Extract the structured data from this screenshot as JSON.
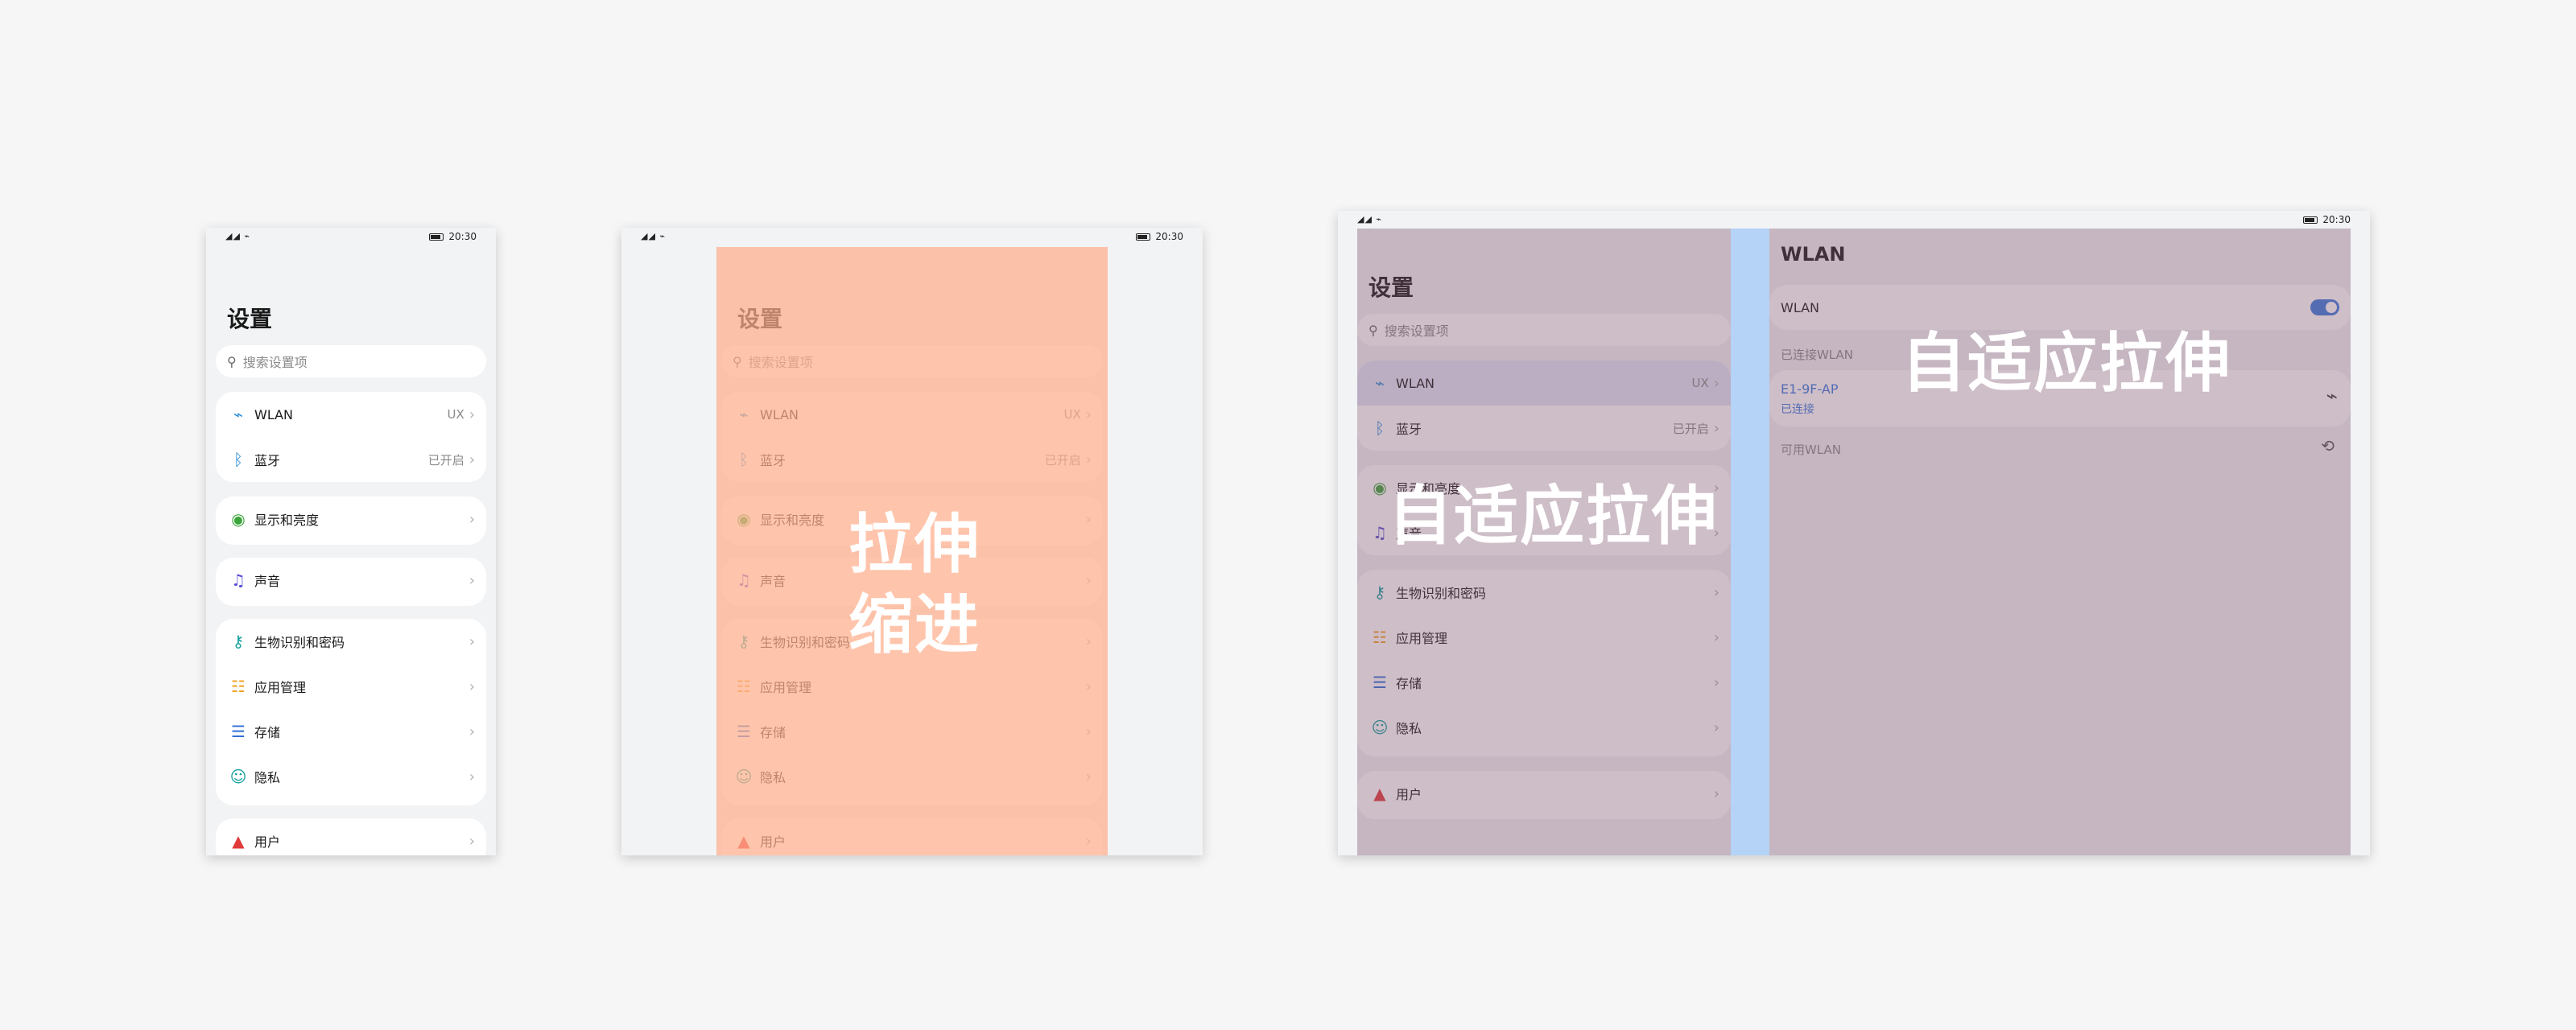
{
  "status_bar": {
    "time": "20:30",
    "signal": "◢◢ ⌁"
  },
  "settings": {
    "title": "设置",
    "search_placeholder": "搜索设置项",
    "items": [
      {
        "icon": "wifi-icon",
        "glyph": "⌁",
        "color": "#2f8fd6",
        "label": "WLAN",
        "value": "UX"
      },
      {
        "icon": "bluetooth-icon",
        "glyph": "ᛒ",
        "color": "#2f8fd6",
        "label": "蓝牙",
        "value": "已开启"
      },
      {
        "icon": "eye-icon",
        "glyph": "◉",
        "color": "#3aa53a",
        "label": "显示和亮度",
        "value": ""
      },
      {
        "icon": "speaker-icon",
        "glyph": "♫",
        "color": "#5a4fd6",
        "label": "声音",
        "value": ""
      },
      {
        "icon": "key-icon",
        "glyph": "⚷",
        "color": "#15a0a0",
        "label": "生物识别和密码",
        "value": ""
      },
      {
        "icon": "apps-icon",
        "glyph": "☷",
        "color": "#f0a020",
        "label": "应用管理",
        "value": ""
      },
      {
        "icon": "storage-icon",
        "glyph": "☰",
        "color": "#2f6fd6",
        "label": "存储",
        "value": ""
      },
      {
        "icon": "privacy-icon",
        "glyph": "☺",
        "color": "#15a0a0",
        "label": "隐私",
        "value": ""
      },
      {
        "icon": "user-icon",
        "glyph": "▲",
        "color": "#e03a3a",
        "label": "用户",
        "value": ""
      }
    ]
  },
  "captions": {
    "stretch": "拉伸",
    "indent": "缩进",
    "adaptive_left": "自适应拉伸",
    "adaptive_right": "自适应拉伸"
  },
  "wlan_detail": {
    "title": "WLAN",
    "toggle_label": "WLAN",
    "connected_header": "已连接WLAN",
    "network_name": "E1-9F-AP",
    "network_status": "已连接",
    "available_header": "可用WLAN"
  },
  "colors": {
    "overlay_orange": "#ffaf8c",
    "overlay_purple": "#7d556e",
    "overlay_blue": "#a0c8f5",
    "accent": "#3b7bdc"
  }
}
